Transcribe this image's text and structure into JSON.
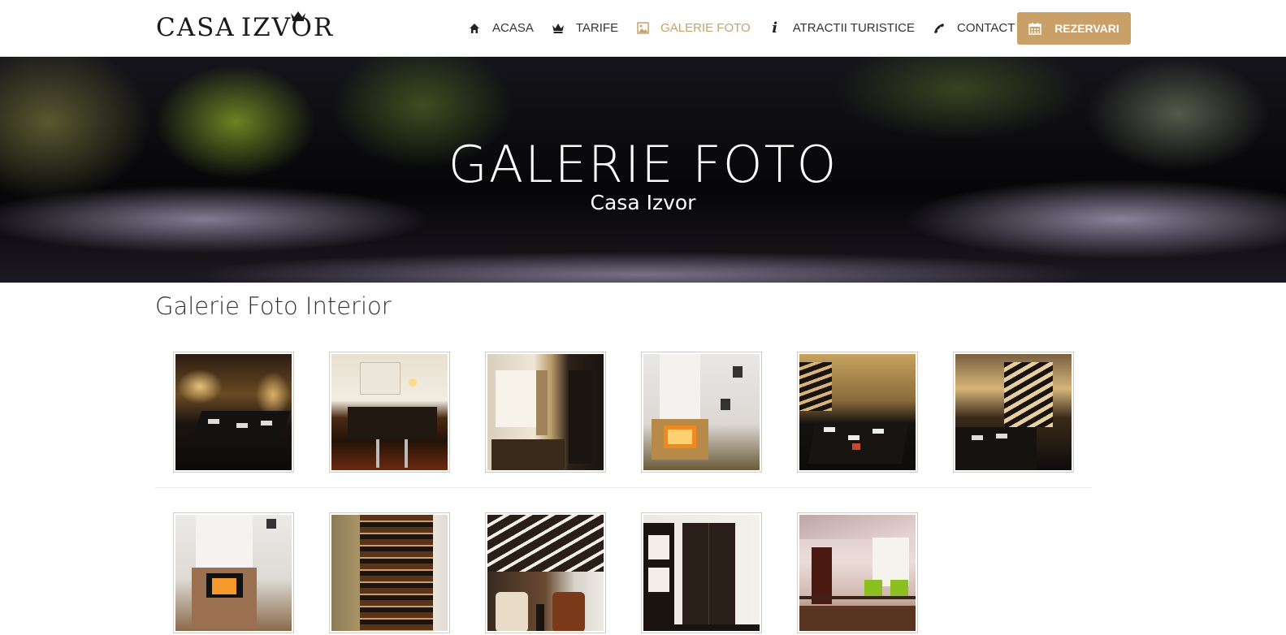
{
  "header": {
    "logo_text_main": "CASA",
    "logo_text_second": "IZVOR",
    "nav": [
      {
        "label": "ACASA",
        "icon": "home-icon"
      },
      {
        "label": "TARIFE",
        "icon": "crown-icon"
      },
      {
        "label": "GALERIE FOTO",
        "icon": "image-icon",
        "active": true
      },
      {
        "label": "ATRACTII TURISTICE",
        "icon": "info-icon"
      },
      {
        "label": "CONTACT",
        "icon": "phone-icon"
      }
    ],
    "cta_label": "REZERVARI",
    "cta_icon": "calendar-icon",
    "accent_color": "#c9a067"
  },
  "hero": {
    "title": "GALERIE FOTO",
    "subtitle": "Casa Izvor"
  },
  "gallery": {
    "title": "Galerie Foto Interior",
    "photos": [
      {
        "name": "dining-room-photo"
      },
      {
        "name": "kitchen-bar-photo"
      },
      {
        "name": "window-shelves-photo"
      },
      {
        "name": "fireplace-photo"
      },
      {
        "name": "dining-table-stairs-photo"
      },
      {
        "name": "stairs-dining-photo"
      },
      {
        "name": "fireplace-corner-photo"
      },
      {
        "name": "wooden-stairs-photo"
      },
      {
        "name": "armchairs-stairs-photo"
      },
      {
        "name": "wardrobe-room-photo"
      },
      {
        "name": "loft-green-chairs-photo"
      }
    ]
  }
}
